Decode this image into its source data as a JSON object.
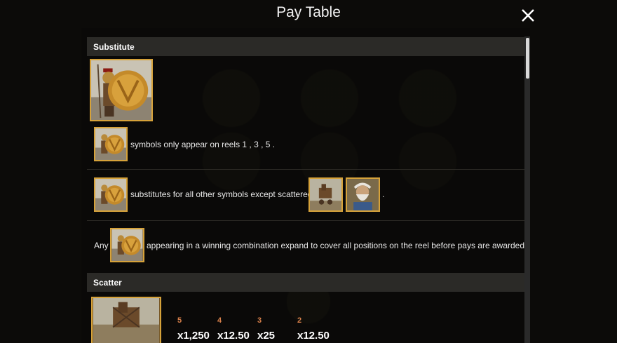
{
  "window": {
    "title": "Pay Table"
  },
  "colors": {
    "accent_gold": "#d6a23a",
    "count_orange": "#d8804a",
    "header_bg": "#2b2a27"
  },
  "icons": {
    "close": "close-icon",
    "spartan": "spartan-warrior-symbol-icon",
    "scatter_a": "trojan-horse-symbol-icon",
    "scatter_b": "zeus-symbol-icon"
  },
  "sections": {
    "substitute": {
      "header": "Substitute",
      "line1": {
        "text": "symbols only appear on reels 1 , 3 , 5 ."
      },
      "line2": {
        "text": "substitutes for all other symbols except scattered",
        "trailing": "."
      },
      "line3": {
        "prefix": "Any",
        "text": "appearing in a winning combination expand to cover all positions on the reel before pays are awarded."
      }
    },
    "scatter": {
      "header": "Scatter",
      "pays": [
        {
          "count": "5",
          "value": "x1,250"
        },
        {
          "count": "4",
          "value": "x12.50"
        },
        {
          "count": "3",
          "value": "x25"
        },
        {
          "count": "2",
          "value": "x12.50"
        }
      ]
    }
  }
}
